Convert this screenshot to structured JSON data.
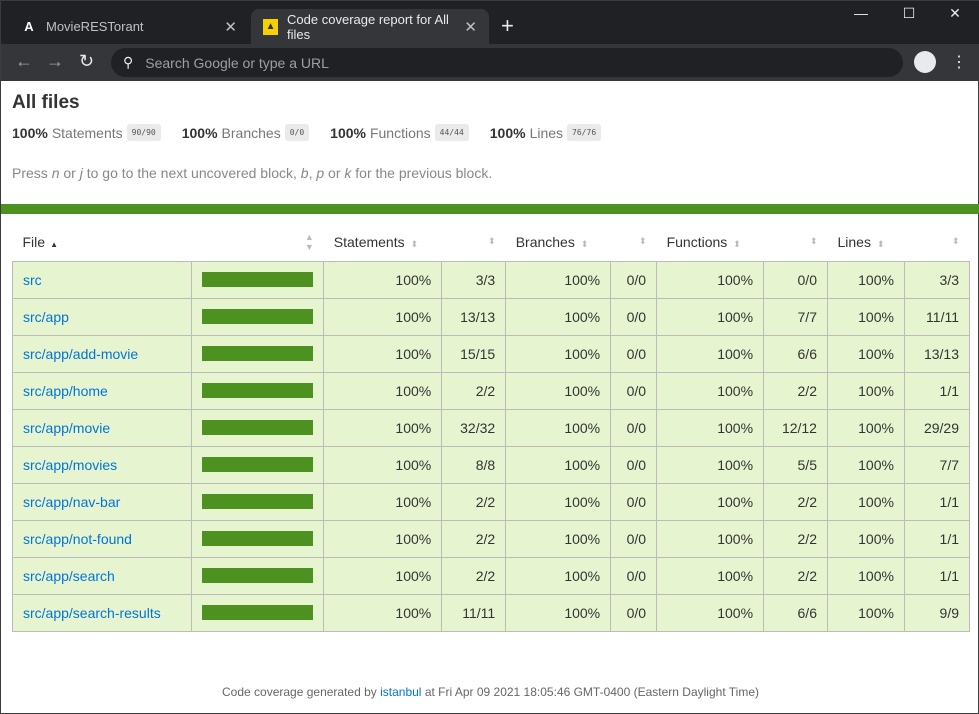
{
  "browser": {
    "tabs": [
      {
        "title": "MovieRESTorant",
        "icon": "angular-icon"
      },
      {
        "title": "Code coverage report for All files",
        "icon": "istanbul-icon"
      }
    ],
    "omnibox_placeholder": "Search Google or type a URL"
  },
  "page": {
    "title": "All files",
    "summary": [
      {
        "pct": "100%",
        "label": "Statements",
        "frac": "90/90"
      },
      {
        "pct": "100%",
        "label": "Branches",
        "frac": "0/0"
      },
      {
        "pct": "100%",
        "label": "Functions",
        "frac": "44/44"
      },
      {
        "pct": "100%",
        "label": "Lines",
        "frac": "76/76"
      }
    ],
    "hint": {
      "p1": "Press ",
      "n": "n",
      "or1": " or ",
      "j": "j",
      "p2": " to go to the next uncovered block, ",
      "b": "b",
      "c": ", ",
      "p": "p",
      "or2": " or ",
      "k": "k",
      "p3": " for the previous block."
    },
    "accent": "#4d9221",
    "headers": {
      "file": "File",
      "statements": "Statements",
      "branches": "Branches",
      "functions": "Functions",
      "lines": "Lines"
    },
    "rows": [
      {
        "file": "src",
        "coverage": 100,
        "s": "100%",
        "sf": "3/3",
        "b": "100%",
        "bf": "0/0",
        "f": "100%",
        "ff": "0/0",
        "l": "100%",
        "lf": "3/3"
      },
      {
        "file": "src/app",
        "coverage": 100,
        "s": "100%",
        "sf": "13/13",
        "b": "100%",
        "bf": "0/0",
        "f": "100%",
        "ff": "7/7",
        "l": "100%",
        "lf": "11/11"
      },
      {
        "file": "src/app/add-movie",
        "coverage": 100,
        "s": "100%",
        "sf": "15/15",
        "b": "100%",
        "bf": "0/0",
        "f": "100%",
        "ff": "6/6",
        "l": "100%",
        "lf": "13/13"
      },
      {
        "file": "src/app/home",
        "coverage": 100,
        "s": "100%",
        "sf": "2/2",
        "b": "100%",
        "bf": "0/0",
        "f": "100%",
        "ff": "2/2",
        "l": "100%",
        "lf": "1/1"
      },
      {
        "file": "src/app/movie",
        "coverage": 100,
        "s": "100%",
        "sf": "32/32",
        "b": "100%",
        "bf": "0/0",
        "f": "100%",
        "ff": "12/12",
        "l": "100%",
        "lf": "29/29"
      },
      {
        "file": "src/app/movies",
        "coverage": 100,
        "s": "100%",
        "sf": "8/8",
        "b": "100%",
        "bf": "0/0",
        "f": "100%",
        "ff": "5/5",
        "l": "100%",
        "lf": "7/7"
      },
      {
        "file": "src/app/nav-bar",
        "coverage": 100,
        "s": "100%",
        "sf": "2/2",
        "b": "100%",
        "bf": "0/0",
        "f": "100%",
        "ff": "2/2",
        "l": "100%",
        "lf": "1/1"
      },
      {
        "file": "src/app/not-found",
        "coverage": 100,
        "s": "100%",
        "sf": "2/2",
        "b": "100%",
        "bf": "0/0",
        "f": "100%",
        "ff": "2/2",
        "l": "100%",
        "lf": "1/1"
      },
      {
        "file": "src/app/search",
        "coverage": 100,
        "s": "100%",
        "sf": "2/2",
        "b": "100%",
        "bf": "0/0",
        "f": "100%",
        "ff": "2/2",
        "l": "100%",
        "lf": "1/1"
      },
      {
        "file": "src/app/search-results",
        "coverage": 100,
        "s": "100%",
        "sf": "11/11",
        "b": "100%",
        "bf": "0/0",
        "f": "100%",
        "ff": "6/6",
        "l": "100%",
        "lf": "9/9"
      }
    ],
    "footer": {
      "pre": "Code coverage generated by ",
      "link": "istanbul",
      "post": " at Fri Apr 09 2021 18:05:46 GMT-0400 (Eastern Daylight Time)"
    }
  }
}
